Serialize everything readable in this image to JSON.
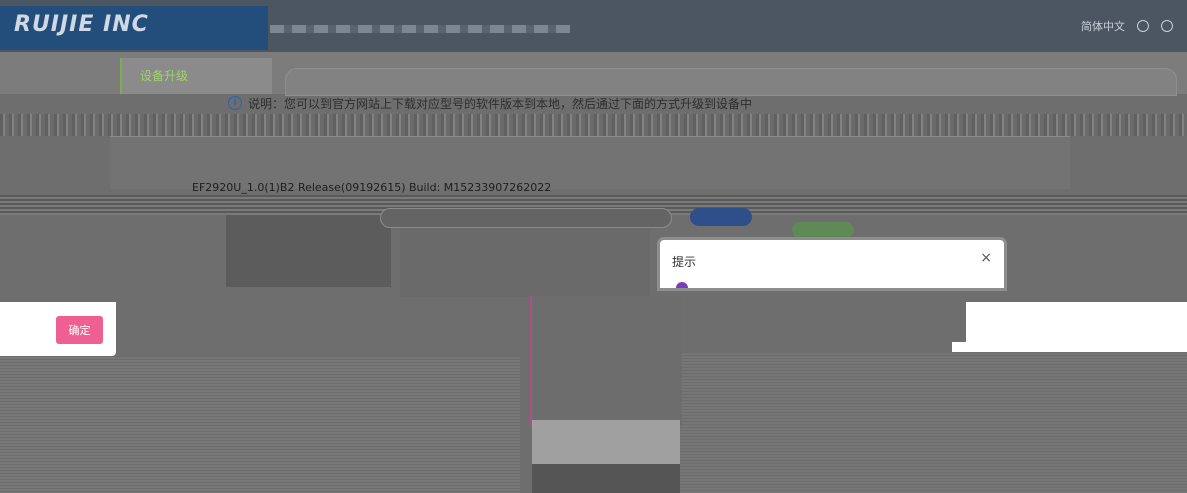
{
  "header": {
    "logo_text": "RUIJIE INC",
    "logo_sub": "",
    "right_text": "简体中文"
  },
  "tabs": {
    "active_label": "设备升级"
  },
  "notice": {
    "text": "说明：您可以到官方网站上下载对应型号的软件版本到本地，然后通过下面的方式升级到设备中"
  },
  "firmware": {
    "version_text": "EF2920U_1.0(1)B2 Release(09192615) Build: M15233907262022"
  },
  "dialog": {
    "title": "提示",
    "close_symbol": "×"
  },
  "footer": {
    "confirm_label": "确定"
  },
  "colors": {
    "confirm_button": "#f05f92",
    "active_tab_text": "#9fd36a",
    "brand_blue": "#234d7a"
  }
}
